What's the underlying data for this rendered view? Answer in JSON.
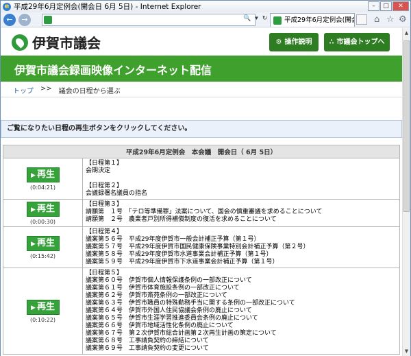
{
  "window": {
    "title": "平成29年6月定例会(開会日 6月 5日) - Internet Explorer",
    "tab_title": "平成29年6月定例会(開会..."
  },
  "header": {
    "site_name": "伊賀市議会",
    "btn_help": "操作説明",
    "btn_top": "市議会トップへ"
  },
  "banner": {
    "title": "伊賀市議会録画映像インターネット配信"
  },
  "breadcrumb": {
    "home": "トップ",
    "sep": ">>",
    "current": "議会の日程から選ぶ"
  },
  "notice": "ご覧になりたい日程の再生ボタンをクリックしてください。",
  "table": {
    "caption": "平成29年6月定例会　本会議　開会日（ 6月 5日）",
    "play_label": "再生",
    "rows": [
      {
        "duration": "(0:04:21)",
        "lines": [
          "【日程第１】",
          "会期決定",
          "",
          "【日程第２】",
          "会議録署名議員の指名"
        ]
      },
      {
        "duration": "(0:00:30)",
        "lines": [
          "【日程第３】",
          "請願第　１号　「テロ等準備罪」法案について、国会の慎重審議を求めることについて",
          "請願第　２号　農業者戸別所得補償制度の復活を求めることについて"
        ]
      },
      {
        "duration": "(0:15:42)",
        "lines": [
          "【日程第４】",
          "議案第５６号　平成29年度伊賀市一般会計補正予算（第１号）",
          "議案第５７号　平成29年度伊賀市国民健康保険事業特別会計補正予算（第２号）",
          "議案第５８号　平成29年度伊賀市水道事業会計補正予算（第１号）",
          "議案第５９号　平成29年度伊賀市下水道事業会計補正予算（第１号）"
        ]
      },
      {
        "duration": "(0:10:22)",
        "lines": [
          "【日程第５】",
          "議案第６０号　伊賀市個人情報保護条例の一部改正について",
          "議案第６１号　伊賀市体育施設条例の一部改正について",
          "議案第６２号　伊賀市斎苑条例の一部改正について",
          "議案第６３号　伊賀市職員の特殊勤務手当に関する条例の一部改正について",
          "議案第６４号　伊賀市外国人住民協議会条例の廃止について",
          "議案第６５号　伊賀市生涯学習推進委員会条例の廃止について",
          "議案第６６号　伊賀市地域活性化条例の廃止について",
          "議案第６７号　第２次伊賀市総合計画第２次再生計画の策定について",
          "議案第６８号　工事請負契約の締結について",
          "議案第６９号　工事請負契約の変更について"
        ]
      }
    ]
  },
  "colors": {
    "brand_green": "#3fa02d",
    "button_green": "#2f7d22",
    "play_green": "#35a23a"
  }
}
